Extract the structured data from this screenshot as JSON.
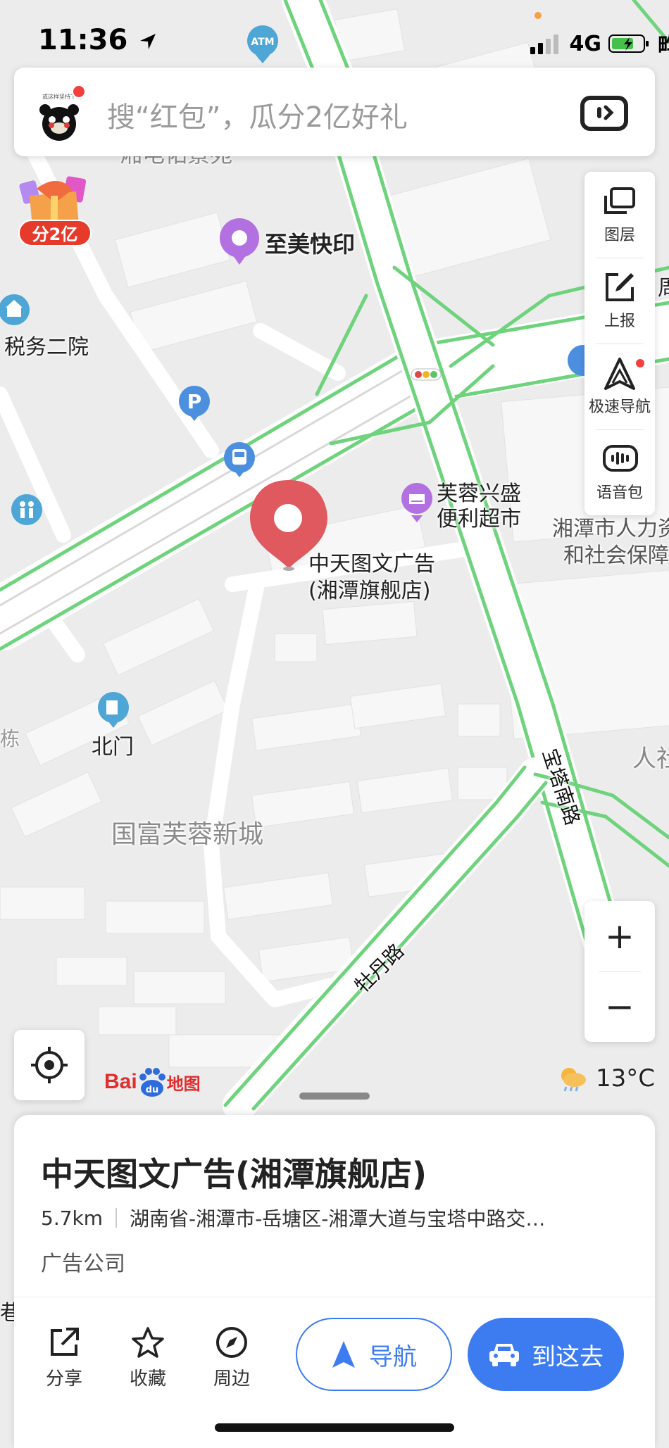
{
  "status_bar": {
    "time": "11:36",
    "network": "4G",
    "carrier_partial": "畇"
  },
  "search": {
    "placeholder": "搜“红包”，瓜分2亿好礼",
    "avatar_caption": "或这样坚持下"
  },
  "promo": {
    "label": "分2亿"
  },
  "toolbar": {
    "layers": "图层",
    "report": "上报",
    "fast_nav": "极速导航",
    "voice_pack": "语音包"
  },
  "map_labels": {
    "top_area_partial": "湘电佑景苑",
    "zhimei": "至美快印",
    "tax": "税务二院",
    "furong_line1": "芙蓉兴盛",
    "furong_line2": "便利超市",
    "hr_line1": "湘潭市人力资",
    "hr_line2": "和社会保障",
    "marker_line1": "中天图文广告",
    "marker_line2": "(湘潭旗舰店)",
    "north_gate": "北门",
    "left_partial": "栋",
    "residential": "国富芙蓉新城",
    "road_baota": "宝塔南路",
    "road_mudan": "牡丹路",
    "right_partial": "人社",
    "right_top_partial": "周",
    "left_bottom_partial": "巷",
    "atm": "ATM"
  },
  "brand": {
    "bai": "Bai",
    "du": "du",
    "ditu": "地图"
  },
  "weather": {
    "temp": "13°C"
  },
  "zoom": {
    "in": "+",
    "out": "−"
  },
  "poi": {
    "title": "中天图文广告(湘潭旗舰店)",
    "distance": "5.7km",
    "address": "湖南省-湘潭市-岳塘区-湘潭大道与宝塔中路交…",
    "category": "广告公司"
  },
  "actions": {
    "share": "分享",
    "favorite": "收藏",
    "nearby": "周边",
    "navigate": "导航",
    "go_here": "到这去"
  },
  "colors": {
    "accent": "#3c7cf0",
    "road_green": "#6ed37c",
    "marker_red": "#e0595f",
    "poi_purple": "#b270e0",
    "poi_blue": "#4da6d6"
  }
}
